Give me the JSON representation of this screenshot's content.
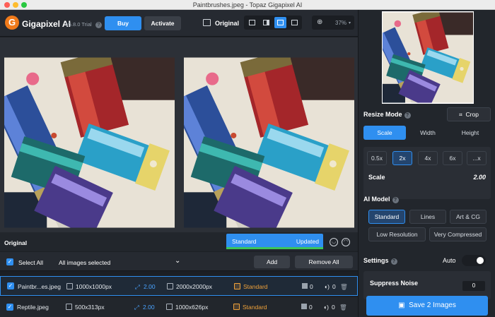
{
  "window": {
    "title": "Paintbrushes.jpeg - Topaz Gigapixel AI"
  },
  "header": {
    "logo_letter": "G",
    "app_name": "Gigapixel AI",
    "version": "v5.8.0 Trial",
    "buy_label": "Buy",
    "activate_label": "Activate",
    "original_label": "Original",
    "zoom": "37%"
  },
  "preview": {
    "original_label": "Original",
    "model_name": "Standard",
    "model_status": "Updated"
  },
  "list": {
    "select_all_label": "Select All",
    "selection_status": "All images selected",
    "add_label": "Add",
    "remove_all_label": "Remove All",
    "rows": [
      {
        "name": "Paintbr...es.jpeg",
        "input_size": "1000x1000px",
        "scale": "2.00",
        "output_size": "2000x2000px",
        "model": "Standard",
        "count": "0"
      },
      {
        "name": "Reptile.jpeg",
        "input_size": "500x313px",
        "scale": "2.00",
        "output_size": "1000x626px",
        "model": "Standard",
        "count": "0"
      }
    ]
  },
  "panel": {
    "resize_mode_title": "Resize Mode",
    "crop_label": "Crop",
    "resize_tabs": [
      "Scale",
      "Width",
      "Height"
    ],
    "scale_options": [
      "0.5x",
      "2x",
      "4x",
      "6x",
      "...x"
    ],
    "scale_label": "Scale",
    "scale_value": "2.00",
    "ai_model_title": "AI Model",
    "models": [
      "Standard",
      "Lines",
      "Art & CG",
      "Low Resolution",
      "Very Compressed"
    ],
    "settings_title": "Settings",
    "auto_label": "Auto",
    "suppress_noise_label": "Suppress Noise",
    "suppress_noise_value": "0",
    "save_label": "Save 2 Images"
  },
  "colors": {
    "accent": "#2f8ff0",
    "highlight": "#f0a23a",
    "success": "#3cc45a",
    "logo": "#f07a1a"
  },
  "icons": [
    "logo-icon",
    "help-icon",
    "image-icon",
    "view-single-icon",
    "view-split-icon",
    "view-side-icon",
    "view-grid-icon",
    "zoom-icon",
    "crop-icon",
    "smile-icon",
    "frown-icon",
    "chevron-down-icon",
    "checkbox-icon",
    "trash-icon",
    "save-icon"
  ]
}
